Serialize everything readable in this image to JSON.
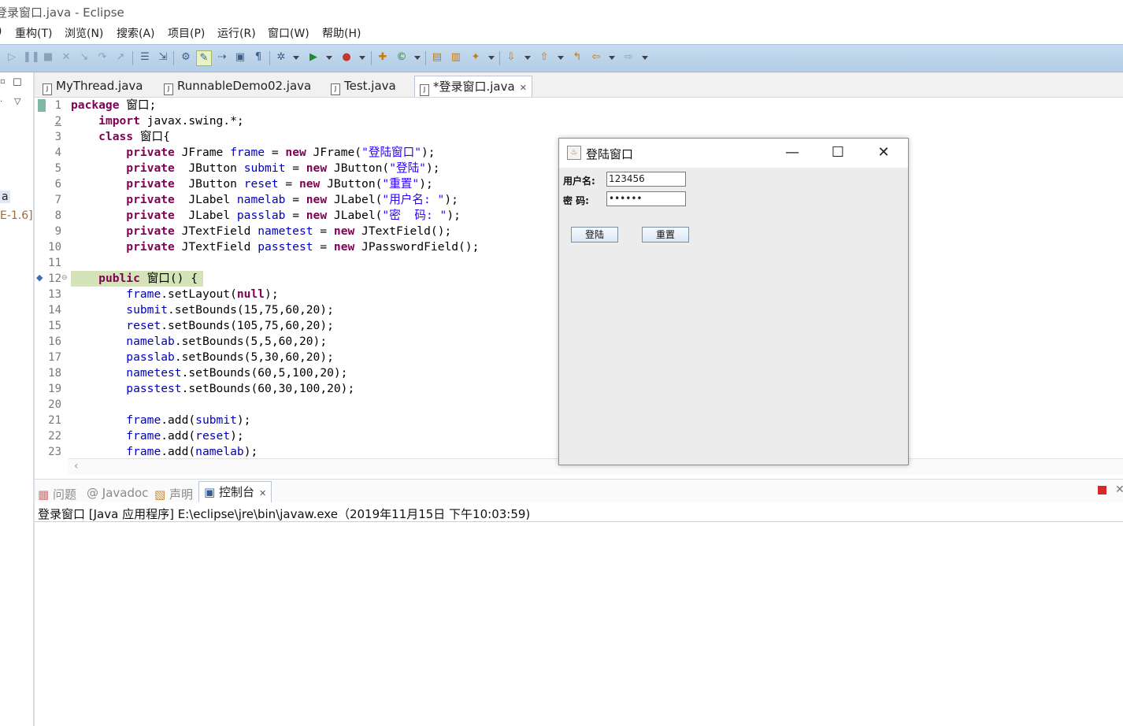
{
  "window_title": "登录窗口.java  -  Eclipse",
  "menu": [
    {
      "key": "m0",
      "label": ")"
    },
    {
      "key": "m1",
      "label": "重构(T)"
    },
    {
      "key": "m2",
      "label": "浏览(N)"
    },
    {
      "key": "m3",
      "label": "搜索(A)"
    },
    {
      "key": "m4",
      "label": "项目(P)"
    },
    {
      "key": "m5",
      "label": "运行(R)"
    },
    {
      "key": "m6",
      "label": "窗口(W)"
    },
    {
      "key": "m7",
      "label": "帮助(H)"
    }
  ],
  "left_strip": {
    "label_a": "a",
    "label_jre": "E-1.6]"
  },
  "editor_tabs": [
    {
      "label": "MyThread.java"
    },
    {
      "label": "RunnableDemo02.java"
    },
    {
      "label": "Test.java"
    },
    {
      "label": "*登录窗口.java",
      "active": true
    }
  ],
  "code": {
    "line_numbers": [
      "1",
      "2",
      "3",
      "4",
      "5",
      "6",
      "7",
      "8",
      "9",
      "10",
      "11",
      "12",
      "13",
      "14",
      "15",
      "16",
      "17",
      "18",
      "19",
      "20",
      "21",
      "22",
      "23"
    ]
  },
  "login_window": {
    "title": "登陆窗口",
    "username_label": "用户名:",
    "password_label": "密  码:",
    "username_value": "123456",
    "password_value": "••••••",
    "submit_label": "登陆",
    "reset_label": "重置"
  },
  "console_tabs": [
    {
      "label": "问题"
    },
    {
      "label": "@ Javadoc"
    },
    {
      "label": "声明"
    },
    {
      "label": "控制台",
      "active": true
    }
  ],
  "console_line": "登录窗口 [Java 应用程序] E:\\eclipse\\jre\\bin\\javaw.exe（2019年11月15日 下午10:03:59)",
  "colors": {
    "keyword": "#7f0055",
    "field": "#0000c0",
    "string": "#2a00ff",
    "toolbar": "#c6dbee",
    "highlight": "#d4e3b8"
  }
}
